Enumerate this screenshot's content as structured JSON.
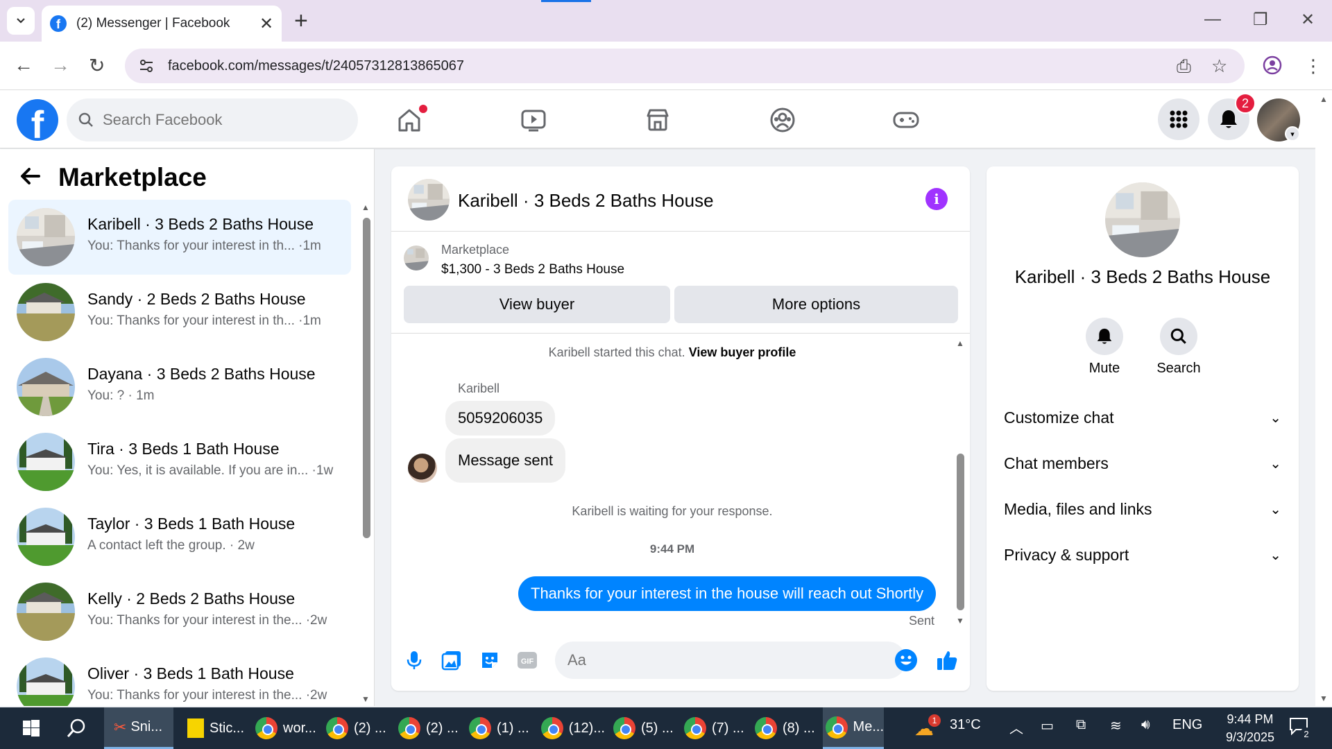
{
  "browser": {
    "tab_title": "(2) Messenger | Facebook",
    "url": "facebook.com/messages/t/24057312813865067"
  },
  "fb": {
    "search_placeholder": "Search Facebook",
    "notification_count": "2"
  },
  "sidebar": {
    "title": "Marketplace",
    "chats": [
      {
        "name": "Karibell · 3 Beds 2 Baths House",
        "preview": "You: Thanks for your interest in th...  ·1m",
        "active": true
      },
      {
        "name": "Sandy · 2 Beds 2 Baths House",
        "preview": "You: Thanks for your interest in th...  ·1m"
      },
      {
        "name": "Dayana · 3 Beds 2 Baths House",
        "preview": "You: ? · 1m"
      },
      {
        "name": "Tira · 3 Beds 1 Bath House",
        "preview": "You: Yes, it is available. If you are in...  ·1w"
      },
      {
        "name": "Taylor · 3 Beds 1 Bath House",
        "preview": "A contact left the group. · 2w"
      },
      {
        "name": "Kelly · 2 Beds 2 Baths House",
        "preview": "You: Thanks for your interest in the... ·2w"
      },
      {
        "name": "Oliver · 3 Beds 1 Bath House",
        "preview": "You: Thanks for your interest in the... ·2w"
      }
    ]
  },
  "conversation": {
    "title": "Karibell · 3 Beds 2 Baths House",
    "listing_label": "Marketplace",
    "listing_title": "$1,300 - 3 Beds 2 Baths House",
    "view_buyer": "View buyer",
    "more_options": "More options",
    "started_text": "Karibell started this chat.",
    "view_profile": "View buyer profile",
    "sender": "Karibell",
    "incoming": [
      "5059206035",
      "Message sent"
    ],
    "waiting": "Karibell is waiting for your response.",
    "time": "9:44 PM",
    "outgoing": "Thanks for your interest in the house will reach out Shortly",
    "sent_status": "Sent",
    "composer_placeholder": "Aa"
  },
  "info_panel": {
    "name": "Karibell · 3 Beds 2 Baths House",
    "mute": "Mute",
    "search": "Search",
    "sections": [
      "Customize chat",
      "Chat members",
      "Media, files and links",
      "Privacy & support"
    ]
  },
  "taskbar": {
    "items": [
      "Sni...",
      "Stic...",
      "wor...",
      "(2) ...",
      "(2) ...",
      "(1) ...",
      "(12)...",
      "(5) ...",
      "(7) ...",
      "(8) ...",
      "Me..."
    ],
    "weather_badge": "1",
    "temperature": "31°C",
    "language": "ENG",
    "time": "9:44 PM",
    "date": "9/3/2025",
    "notifications": "2"
  },
  "colors": {
    "facebook_blue": "#1877f2",
    "messenger_blue": "#0084ff",
    "info_purple": "#a033ff",
    "active_chat_bg": "#ebf5ff",
    "badge_red": "#e41e3f"
  }
}
